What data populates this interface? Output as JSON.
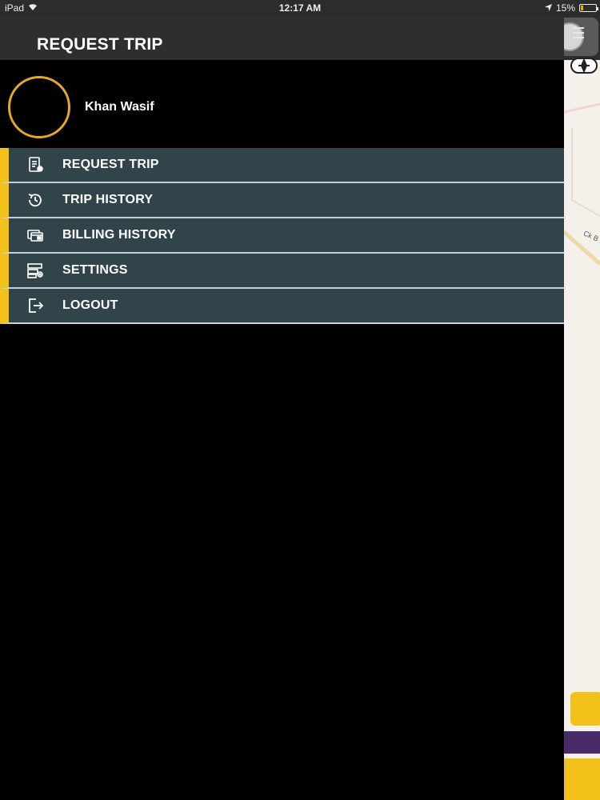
{
  "status_bar": {
    "device": "iPad",
    "time": "12:17 AM",
    "battery": "15%",
    "battery_level": 0.15
  },
  "header": {
    "title": "REQUEST TRIP"
  },
  "profile": {
    "name": "Khan Wasif"
  },
  "menu": {
    "items": [
      {
        "label": "REQUEST TRIP",
        "icon": "request-trip-icon"
      },
      {
        "label": "TRIP HISTORY",
        "icon": "history-clock-icon"
      },
      {
        "label": "BILLING HISTORY",
        "icon": "billing-card-icon"
      },
      {
        "label": "SETTINGS",
        "icon": "settings-server-icon"
      },
      {
        "label": "LOGOUT",
        "icon": "logout-icon"
      }
    ]
  },
  "map": {
    "road_label": "Ck B"
  },
  "colors": {
    "accent": "#f2c21b",
    "menu_bg": "#30444a",
    "avatar_ring": "#e8a826",
    "header_bg": "#2e2e2e"
  }
}
